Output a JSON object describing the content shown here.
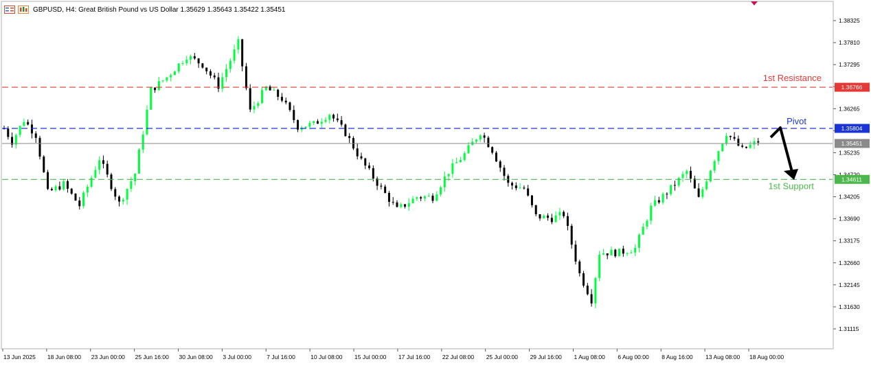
{
  "window": {
    "symbol": "GBPUSD",
    "timeframe": "H4",
    "description": "Great British Pound vs US Dollar",
    "ohlc": "1.35629 1.35643 1.35422 1.35451",
    "title_text": "GBPUSD, H4:  Great British Pound vs US Dollar  1.35629 1.35643 1.35422 1.35451"
  },
  "colors": {
    "bull": "#00ff3c",
    "bear": "#000000",
    "resistance": "#e53935",
    "pivot": "#1a35d6",
    "support": "#4cb84c",
    "current": "#8a8a8a"
  },
  "axes": {
    "price_ticks": [
      "1.38325",
      "1.37810",
      "1.37295",
      "1.36780",
      "1.36265",
      "1.35750",
      "1.35235",
      "1.34720",
      "1.34205",
      "1.33690",
      "1.33175",
      "1.32660",
      "1.32145",
      "1.31630",
      "1.31115"
    ],
    "time_ticks": [
      "13 Jun 2025",
      "18 Jun 08:00",
      "23 Jun 00:00",
      "25 Jun 16:00",
      "30 Jun 08:00",
      "3 Jul 00:00",
      "7 Jul 16:00",
      "10 Jul 08:00",
      "15 Jul 00:00",
      "17 Jul 16:00",
      "22 Jul 08:00",
      "25 Jul 00:00",
      "29 Jul 16:00",
      "1 Aug 08:00",
      "6 Aug 00:00",
      "8 Aug 16:00",
      "13 Aug 08:00",
      "18 Aug 00:00"
    ]
  },
  "levels": {
    "resistance": {
      "label": "1st Resistance",
      "price": "1.36766"
    },
    "pivot": {
      "label": "Pivot",
      "price": "1.35804"
    },
    "current": {
      "price": "1.35451"
    },
    "support": {
      "label": "1st Support",
      "price": "1.34611"
    }
  },
  "icons": [
    "chart-properties-icon",
    "chart-type-icon",
    "arrow-icon",
    "alert-marker-icon"
  ],
  "chart_data": {
    "type": "candlestick",
    "ylim": [
      1.308,
      1.386
    ],
    "price_path": [
      [
        0,
        1.358
      ],
      [
        2,
        1.355
      ],
      [
        5,
        1.36
      ],
      [
        8,
        1.3565
      ],
      [
        11,
        1.343
      ],
      [
        15,
        1.345
      ],
      [
        19,
        1.34
      ],
      [
        24,
        1.351
      ],
      [
        29,
        1.3405
      ],
      [
        33,
        1.3475
      ],
      [
        37,
        1.367
      ],
      [
        41,
        1.37
      ],
      [
        46,
        1.375
      ],
      [
        50,
        1.373
      ],
      [
        54,
        1.368
      ],
      [
        59,
        1.378
      ],
      [
        62,
        1.362
      ],
      [
        66,
        1.3675
      ],
      [
        70,
        1.365
      ],
      [
        74,
        1.3585
      ],
      [
        78,
        1.359
      ],
      [
        82,
        1.3615
      ],
      [
        86,
        1.357
      ],
      [
        90,
        1.3505
      ],
      [
        95,
        1.344
      ],
      [
        99,
        1.339
      ],
      [
        104,
        1.342
      ],
      [
        108,
        1.342
      ],
      [
        112,
        1.348
      ],
      [
        116,
        1.352
      ],
      [
        120,
        1.3572
      ],
      [
        123,
        1.353
      ],
      [
        127,
        1.345
      ],
      [
        131,
        1.344
      ],
      [
        134,
        1.3375
      ],
      [
        138,
        1.337
      ],
      [
        141,
        1.338
      ],
      [
        145,
        1.324
      ],
      [
        148,
        1.318
      ],
      [
        150,
        1.329
      ],
      [
        155,
        1.329
      ],
      [
        159,
        1.33
      ],
      [
        163,
        1.3395
      ],
      [
        168,
        1.344
      ],
      [
        172,
        1.348
      ],
      [
        175,
        1.3415
      ],
      [
        179,
        1.351
      ],
      [
        182,
        1.357
      ],
      [
        186,
        1.353
      ],
      [
        190,
        1.355
      ]
    ],
    "candle_count": 190
  }
}
